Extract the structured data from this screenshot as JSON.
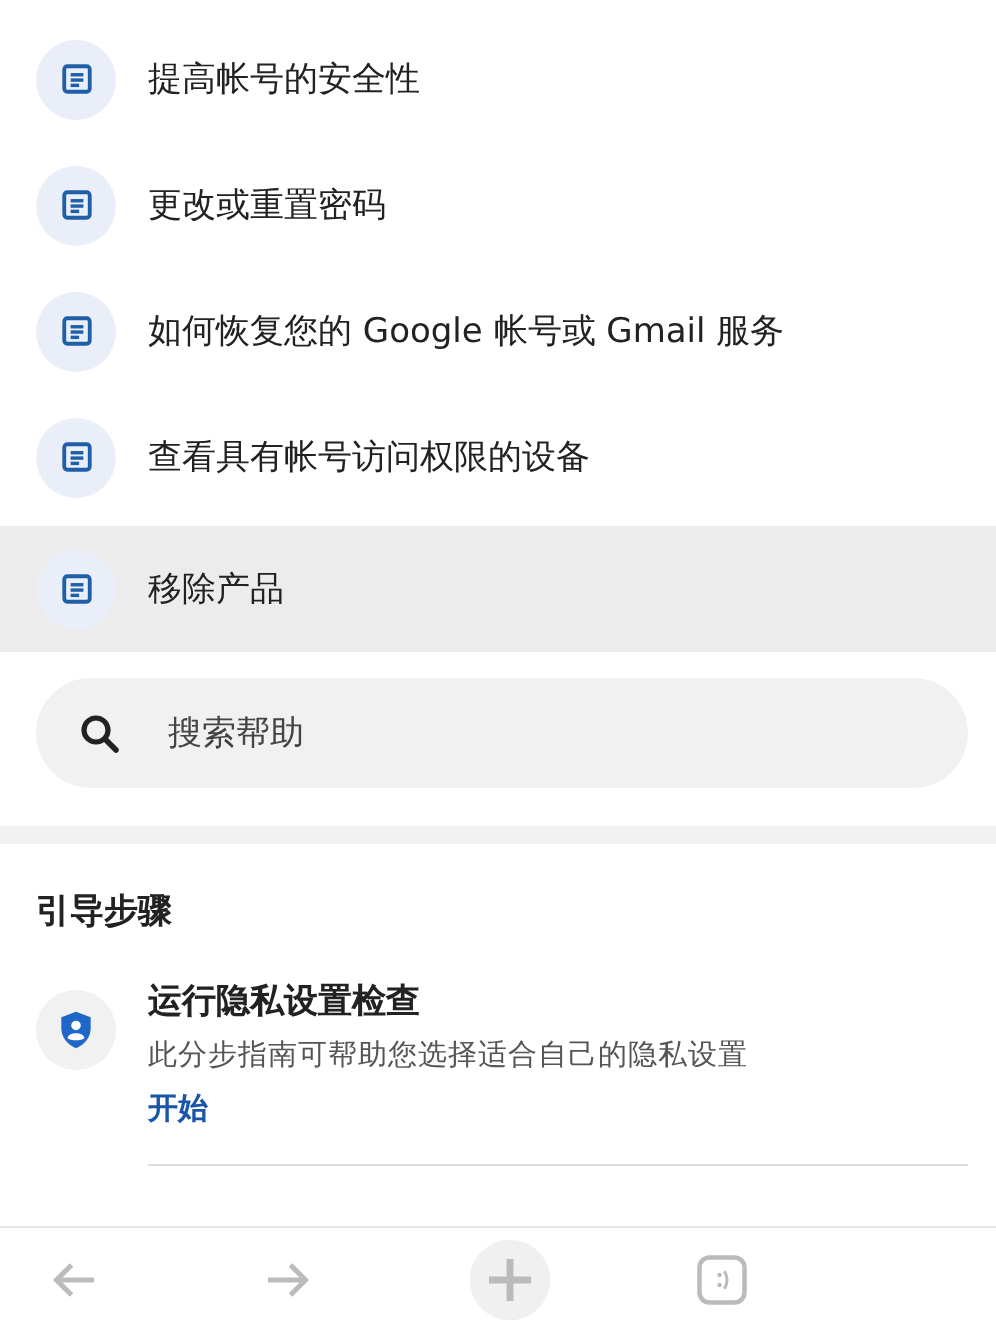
{
  "articles": [
    {
      "title": "提高帐号的安全性",
      "selected": false
    },
    {
      "title": "更改或重置密码",
      "selected": false
    },
    {
      "title": "如何恢复您的 Google 帐号或 Gmail 服务",
      "selected": false
    },
    {
      "title": "查看具有帐号访问权限的设备",
      "selected": false
    },
    {
      "title": "移除产品",
      "selected": true
    }
  ],
  "search": {
    "placeholder": "搜索帮助"
  },
  "guided_steps": {
    "heading": "引导步骤",
    "items": [
      {
        "title": "运行隐私设置检查",
        "description": "此分步指南可帮助您选择适合自己的隐私设置",
        "link": "开始"
      }
    ]
  },
  "toolbar": {
    "buttons": [
      {
        "kind": "back"
      },
      {
        "kind": "forward"
      },
      {
        "kind": "new-tab"
      },
      {
        "kind": "tabs"
      }
    ]
  }
}
